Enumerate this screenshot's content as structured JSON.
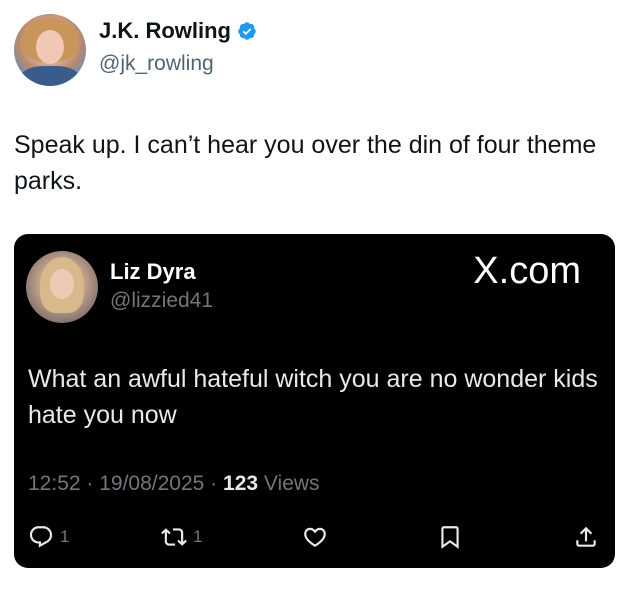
{
  "tweet": {
    "author_name": "J.K. Rowling",
    "author_handle": "@jk_rowling",
    "text": "Speak up. I can’t hear you over the din of four theme parks."
  },
  "quoted": {
    "author_name": "Liz Dyra",
    "author_handle": "@lizzied41",
    "brand": "X.com",
    "text": "What an awful hateful witch you are no wonder kids hate you now",
    "time": "12:52",
    "date": "19/08/2025",
    "views_count": "123",
    "views_label": "Views",
    "replies": "1",
    "reposts": "1"
  },
  "colors": {
    "verified_blue": "#1d9bf0",
    "card_bg": "#000000"
  },
  "icons": [
    "verified-badge-icon",
    "reply-icon",
    "repost-icon",
    "like-icon",
    "bookmark-icon",
    "share-icon"
  ]
}
